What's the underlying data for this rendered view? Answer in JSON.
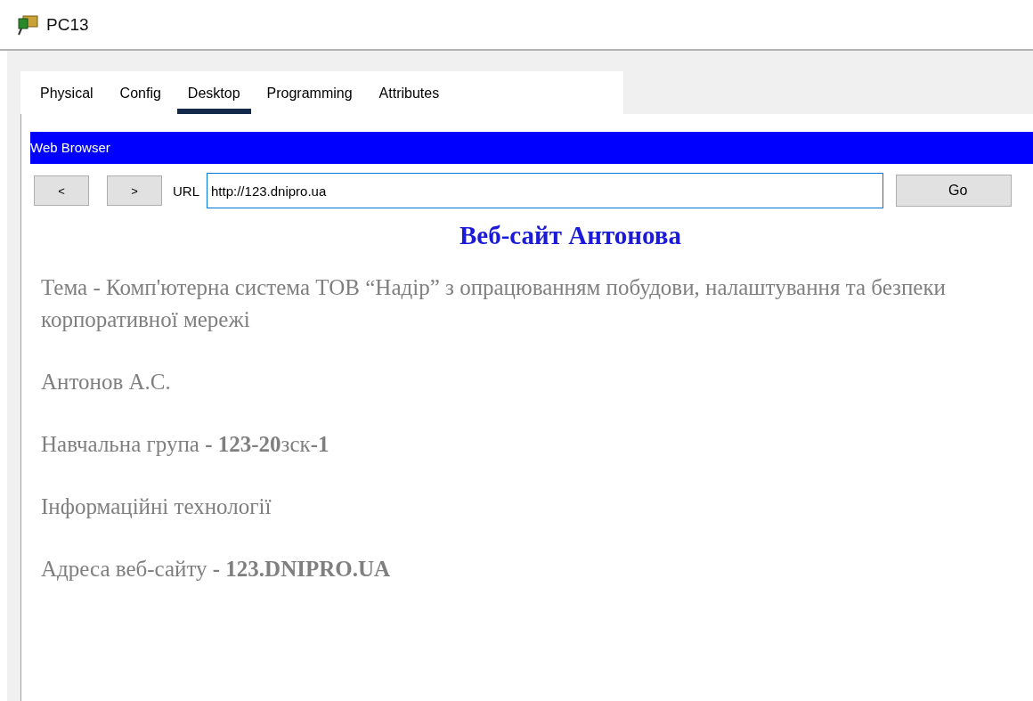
{
  "window": {
    "title": "PC13"
  },
  "tabs": [
    {
      "label": "Physical",
      "selected": false
    },
    {
      "label": "Config",
      "selected": false
    },
    {
      "label": "Desktop",
      "selected": true
    },
    {
      "label": "Programming",
      "selected": false
    },
    {
      "label": "Attributes",
      "selected": false
    }
  ],
  "browser": {
    "title": "Web Browser",
    "back": "<",
    "forward": ">",
    "url_label": "URL",
    "url": "http://123.dnipro.ua",
    "go": "Go"
  },
  "page": {
    "heading": "Веб-сайт Антонова",
    "paragraphs": [
      "Тема - Комп'ютерна система ТОВ “Надір” з опрацюванням побудови, налаштування та безпеки корпоративної мережі",
      "Антонов А.С.",
      "Навчальна група **- 123-20**зск**-1**",
      "Інформаційні технології",
      "Адреса веб-сайту **- 123.DNIPRO.UA**"
    ]
  }
}
